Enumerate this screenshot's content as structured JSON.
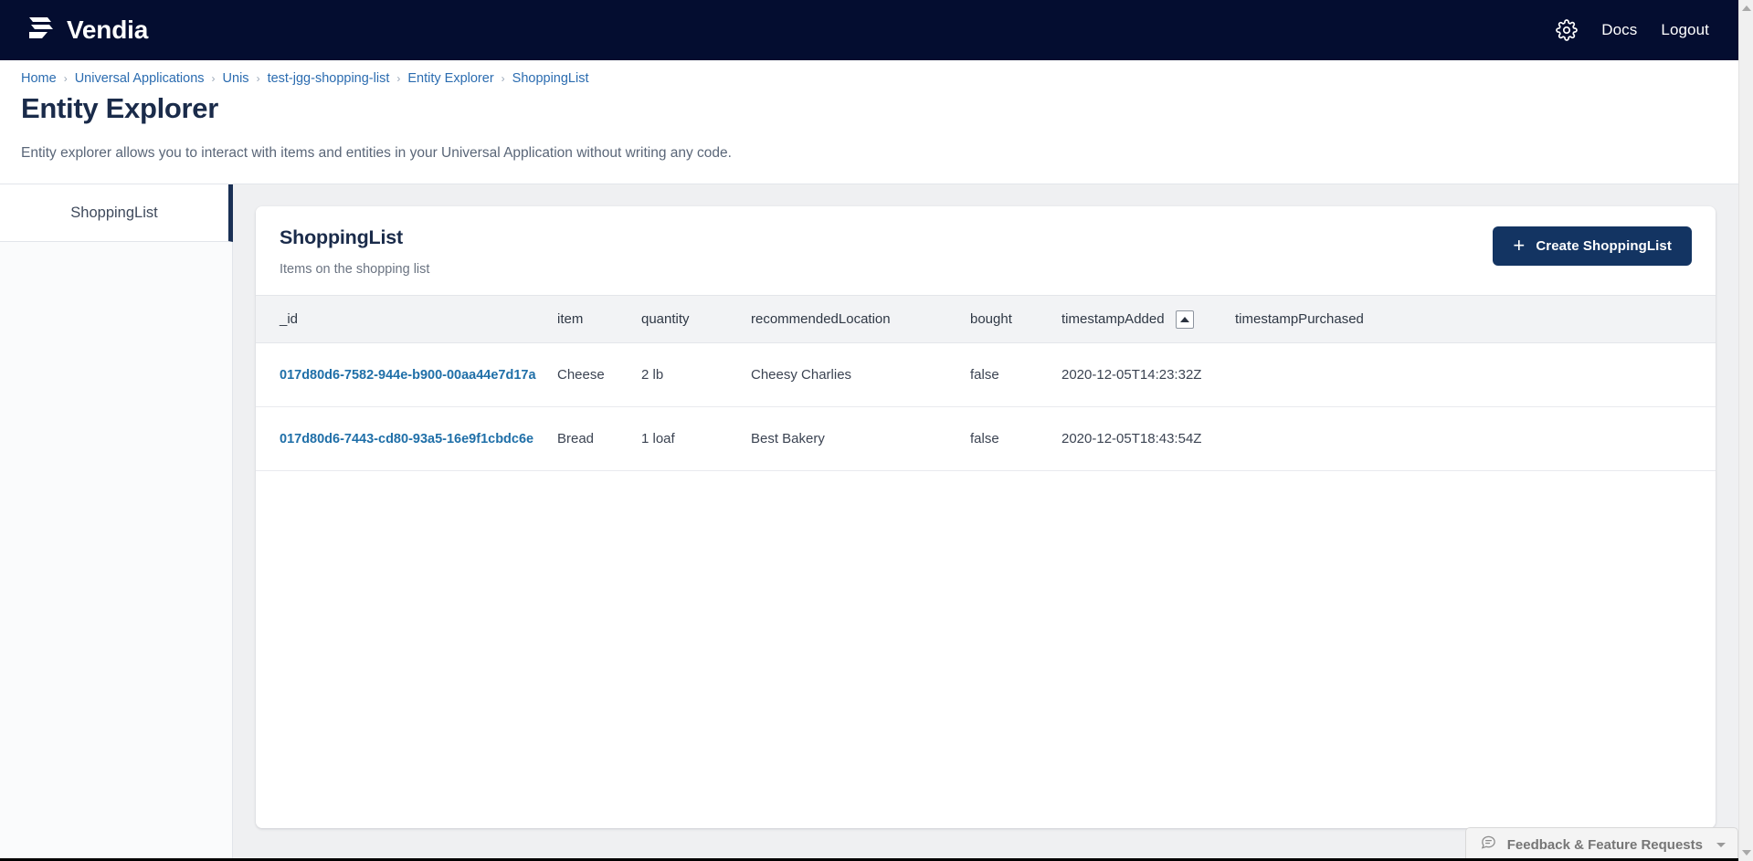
{
  "topnav": {
    "brand": "Vendia",
    "brand_logo_icon": "vendia-logo-icon",
    "settings_icon": "gear-icon",
    "docs_label": "Docs",
    "logout_label": "Logout"
  },
  "breadcrumb": {
    "separator": "›",
    "items": [
      {
        "label": "Home"
      },
      {
        "label": "Universal Applications"
      },
      {
        "label": "Unis"
      },
      {
        "label": "test-jgg-shopping-list"
      },
      {
        "label": "Entity Explorer"
      },
      {
        "label": "ShoppingList"
      }
    ]
  },
  "page": {
    "title": "Entity Explorer",
    "description": "Entity explorer allows you to interact with items and entities in your Universal Application without writing any code."
  },
  "sidebar": {
    "items": [
      {
        "label": "ShoppingList",
        "active": true
      }
    ]
  },
  "card": {
    "title": "ShoppingList",
    "subtitle": "Items on the shopping list",
    "create_button": {
      "label": "Create ShoppingList",
      "icon": "plus-icon"
    }
  },
  "table": {
    "columns": [
      {
        "key": "_id",
        "label": "_id",
        "sortable": false
      },
      {
        "key": "item",
        "label": "item",
        "sortable": false
      },
      {
        "key": "quantity",
        "label": "quantity",
        "sortable": false
      },
      {
        "key": "recommendedLocation",
        "label": "recommendedLocation",
        "sortable": false
      },
      {
        "key": "bought",
        "label": "bought",
        "sortable": false
      },
      {
        "key": "timestampAdded",
        "label": "timestampAdded",
        "sortable": true,
        "sort_direction": "asc",
        "sort_icon": "sort-ascending-icon"
      },
      {
        "key": "timestampPurchased",
        "label": "timestampPurchased",
        "sortable": false
      }
    ],
    "rows": [
      {
        "_id": "017d80d6-7582-944e-b900-00aa44e7d17a",
        "item": "Cheese",
        "quantity": "2 lb",
        "recommendedLocation": "Cheesy Charlies",
        "bought": "false",
        "timestampAdded": "2020-12-05T14:23:32Z",
        "timestampPurchased": ""
      },
      {
        "_id": "017d80d6-7443-cd80-93a5-16e9f1cbdc6e",
        "item": "Bread",
        "quantity": "1 loaf",
        "recommendedLocation": "Best Bakery",
        "bought": "false",
        "timestampAdded": "2020-12-05T18:43:54Z",
        "timestampPurchased": ""
      }
    ]
  },
  "feedback": {
    "label": "Feedback & Feature Requests",
    "icon": "speech-bubble-icon",
    "chevron": "chevron-down-icon"
  },
  "colors": {
    "nav_background": "#040D30",
    "accent_button": "#133462",
    "link": "#2b6cb0",
    "id_link": "#1f6fa8",
    "content_background": "#eff0f2",
    "table_header_background": "#f2f3f5"
  }
}
